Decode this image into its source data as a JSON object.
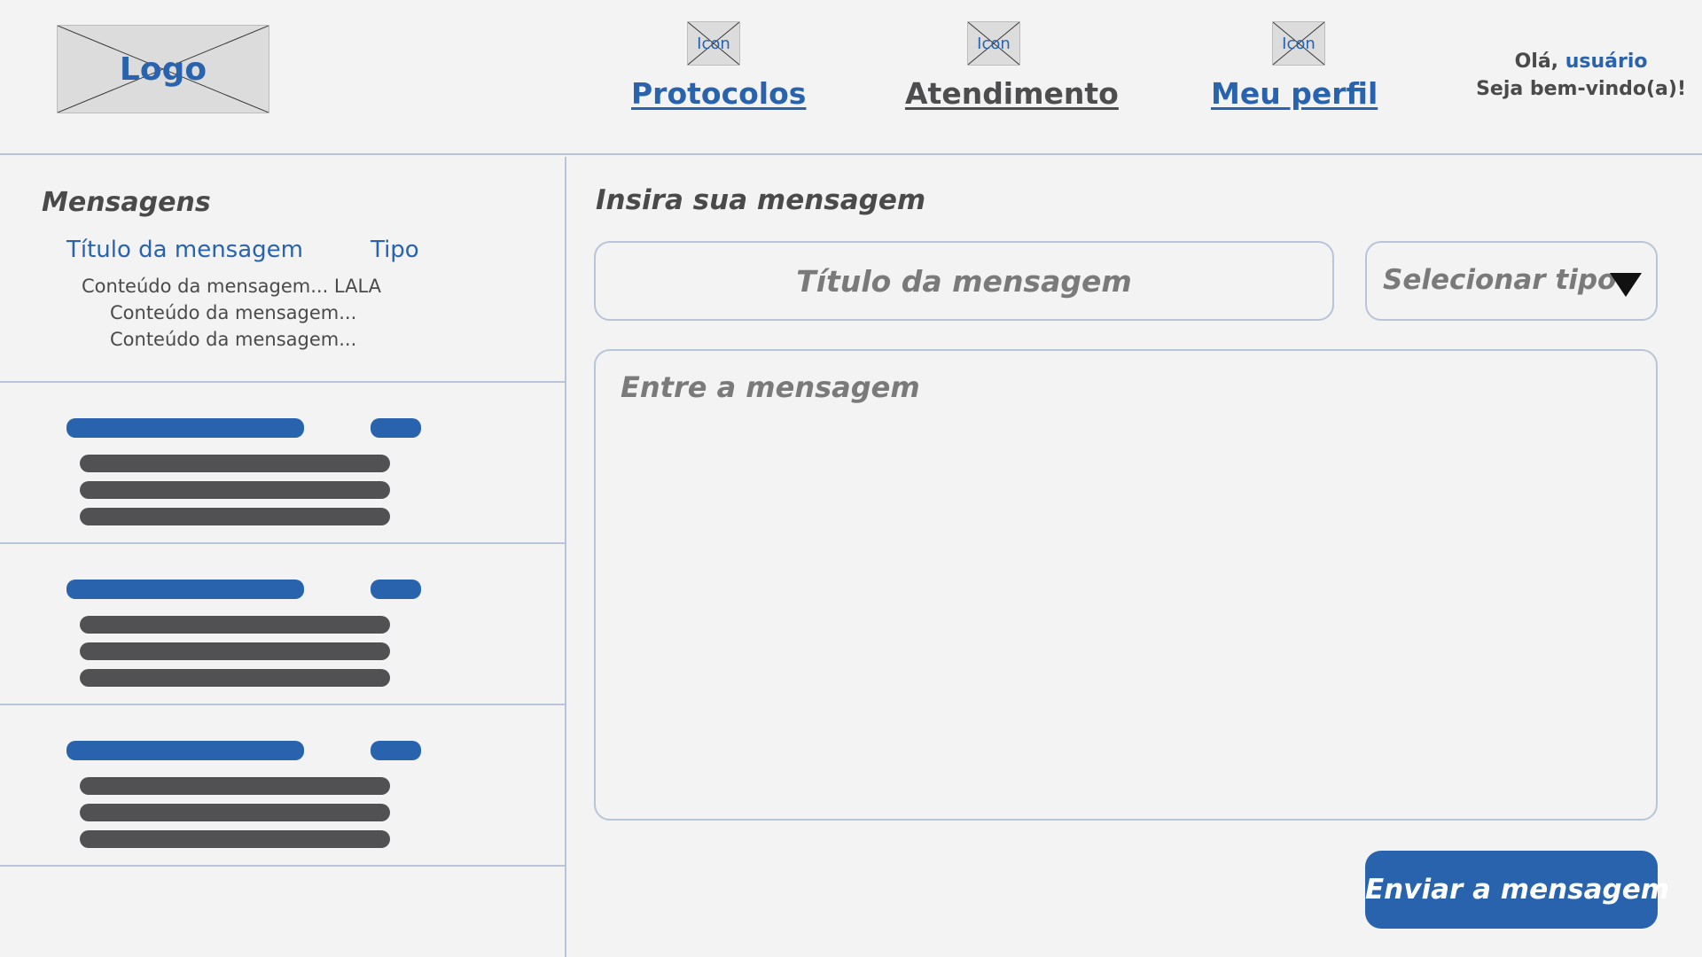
{
  "header": {
    "logo_label": "Logo",
    "nav": [
      {
        "label": "Protocolos",
        "icon_label": "Icon",
        "icon": "placeholder-icon"
      },
      {
        "label": "Atendimento",
        "icon_label": "Icon",
        "icon": "placeholder-icon"
      },
      {
        "label": "Meu perfil",
        "icon_label": "Icon",
        "icon": "placeholder-icon"
      }
    ],
    "greeting": {
      "hello": "Olá,",
      "user": "usuário",
      "welcome": "Seja bem-vindo(a)!"
    }
  },
  "sidebar": {
    "title": "Mensagens",
    "first_message": {
      "title": "Título da mensagem",
      "type": "Tipo",
      "lines": [
        "Conteúdo da mensagem... LALA",
        "Conteúdo da mensagem...",
        "Conteúdo da mensagem..."
      ]
    }
  },
  "compose": {
    "title": "Insira sua mensagem",
    "title_placeholder": "Título da mensagem",
    "type_placeholder": "Selecionar tipo",
    "body_placeholder": "Entre a mensagem",
    "send_label": "Enviar a mensagem"
  },
  "colors": {
    "accent": "#2a63ad",
    "text": "#4a4a4a",
    "background": "#f3f3f3",
    "border": "#b8c4d8"
  }
}
